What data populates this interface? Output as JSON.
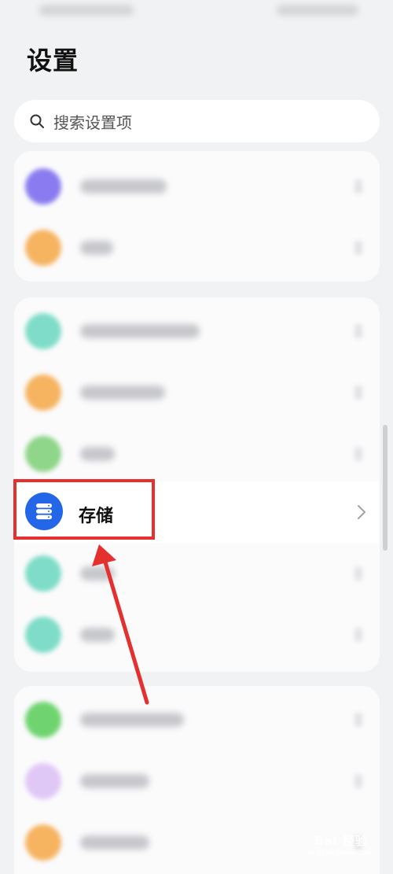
{
  "page": {
    "title": "设置"
  },
  "search": {
    "placeholder": "搜索设置项"
  },
  "storage": {
    "label": "存储"
  },
  "watermark": {
    "text": "Bai 经验",
    "sub": "jingyan.baidu.com"
  },
  "colors": {
    "accent": "#2366e8",
    "highlight": "#e53030",
    "background": "#f1f2f4"
  },
  "blurred_icons": [
    "#8a7cf0",
    "#f6b461",
    "#7fdcc8",
    "#f6b461",
    "#8fd58a",
    "#7fdcc8",
    "#7fdcc8",
    "#6fd46f",
    "#e0c8f6",
    "#f6b461"
  ],
  "icons": {
    "search": "search-icon",
    "storage": "storage-icon",
    "chevron": "chevron-right-icon"
  }
}
